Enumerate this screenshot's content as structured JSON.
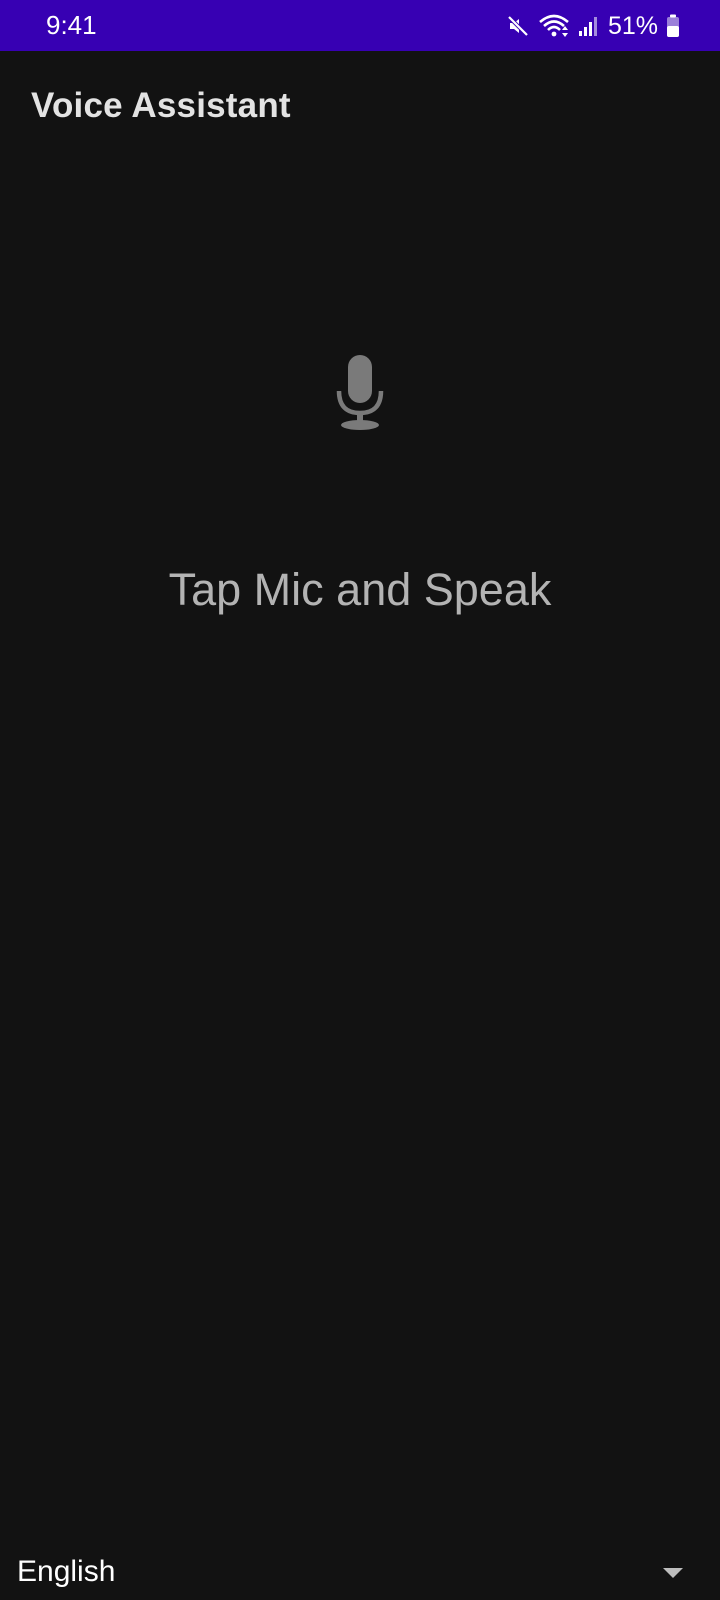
{
  "status_bar": {
    "time": "9:41",
    "battery_percent": "51%",
    "icons": [
      "mute-icon",
      "wifi-icon",
      "signal-icon",
      "battery-icon"
    ],
    "background": "#3700b3"
  },
  "app_bar": {
    "title": "Voice Assistant"
  },
  "main": {
    "mic_icon": "microphone-icon",
    "prompt": "Tap Mic and Speak"
  },
  "language_selector": {
    "selected": "English",
    "icon": "dropdown-arrow-icon"
  },
  "colors": {
    "background": "#121212",
    "title": "#e3e3e3",
    "prompt": "#b3b3b3",
    "mic": "#7a7a7a"
  }
}
